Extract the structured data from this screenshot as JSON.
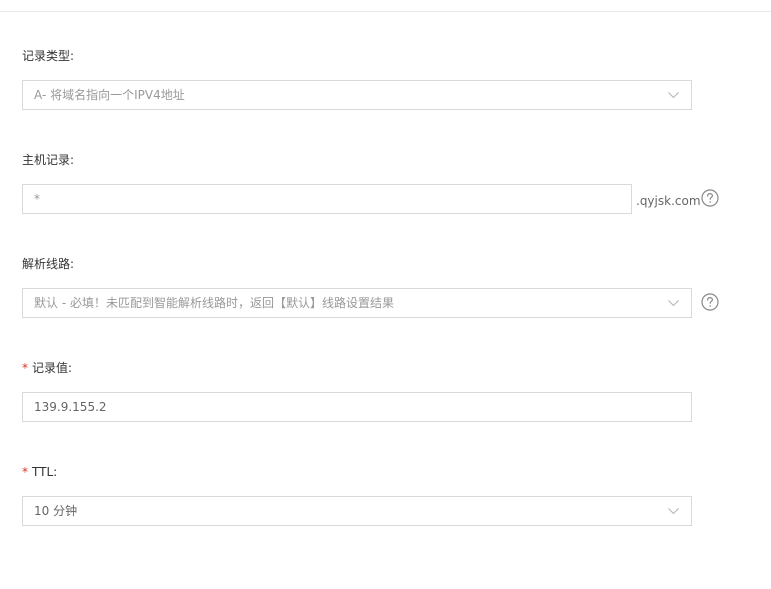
{
  "form": {
    "record_type": {
      "label": "记录类型:",
      "value": "A- 将域名指向一个IPV4地址",
      "icon": "chevron-down-icon"
    },
    "host_record": {
      "label": "主机记录:",
      "value": "*",
      "suffix": ".qyjsk.com",
      "help_icon": "question-circle-icon"
    },
    "resolve_line": {
      "label": "解析线路:",
      "value": "默认 - 必填！未匹配到智能解析线路时，返回【默认】线路设置结果",
      "icon": "chevron-down-icon",
      "help_icon": "question-circle-icon"
    },
    "record_value": {
      "required_mark": "*",
      "label": "记录值:",
      "value": "139.9.155.2"
    },
    "ttl": {
      "required_mark": "*",
      "label": "TTL:",
      "value": "10 分钟",
      "icon": "chevron-down-icon"
    }
  },
  "colors": {
    "border": "#d9d9d9",
    "required": "#e0301e",
    "text": "#333333",
    "muted": "#999999"
  }
}
